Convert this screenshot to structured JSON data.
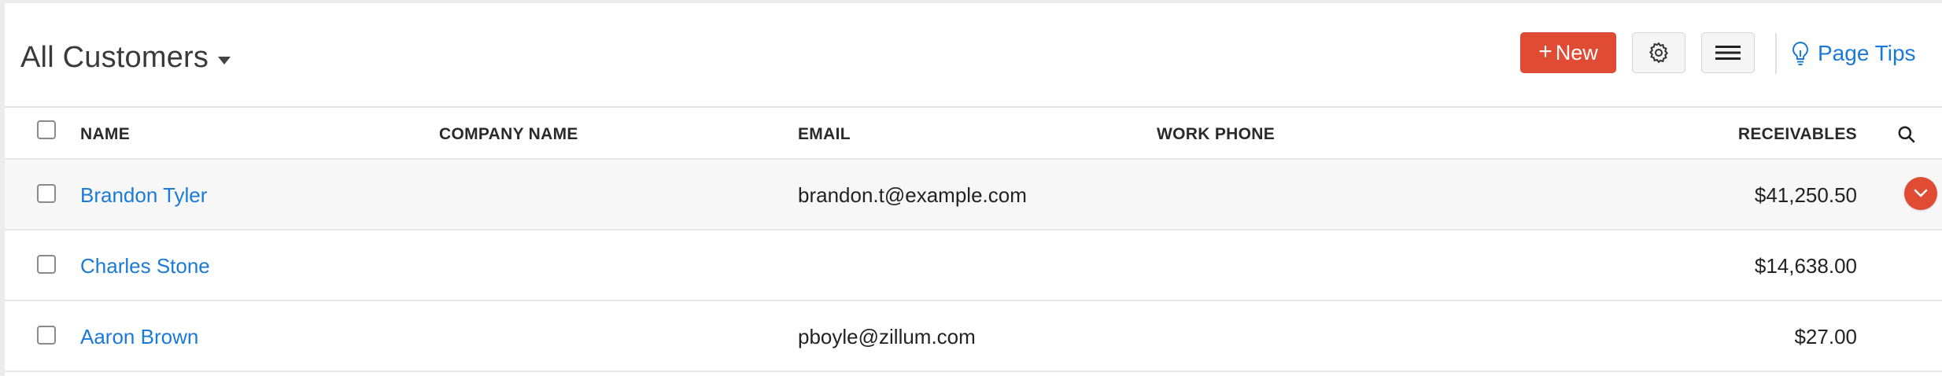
{
  "header": {
    "title": "All Customers",
    "new_button": {
      "plus": "+",
      "label": "New"
    },
    "page_tips": "Page Tips"
  },
  "columns": {
    "name": "NAME",
    "company": "COMPANY NAME",
    "email": "EMAIL",
    "phone": "WORK PHONE",
    "receivables": "RECEIVABLES"
  },
  "rows": [
    {
      "name": "Brandon Tyler",
      "company": "",
      "email": "brandon.t@example.com",
      "phone": "",
      "receivables": "$41,250.50"
    },
    {
      "name": "Charles Stone",
      "company": "",
      "email": "",
      "phone": "",
      "receivables": "$14,638.00"
    },
    {
      "name": "Aaron Brown",
      "company": "",
      "email": "pboyle@zillum.com",
      "phone": "",
      "receivables": "$27.00"
    }
  ],
  "icons": {
    "title_caret": "caret-down-icon",
    "new": "plus-icon",
    "settings": "gear-icon",
    "menu": "hamburger-menu-icon",
    "tips": "lightbulb-icon",
    "search": "search-icon",
    "row_action": "chevron-down-icon"
  },
  "colors": {
    "accent": "#e04b33",
    "link": "#1a7ad8",
    "header_text": "#3a3a3a",
    "row_hover": "#f7f7f7"
  }
}
